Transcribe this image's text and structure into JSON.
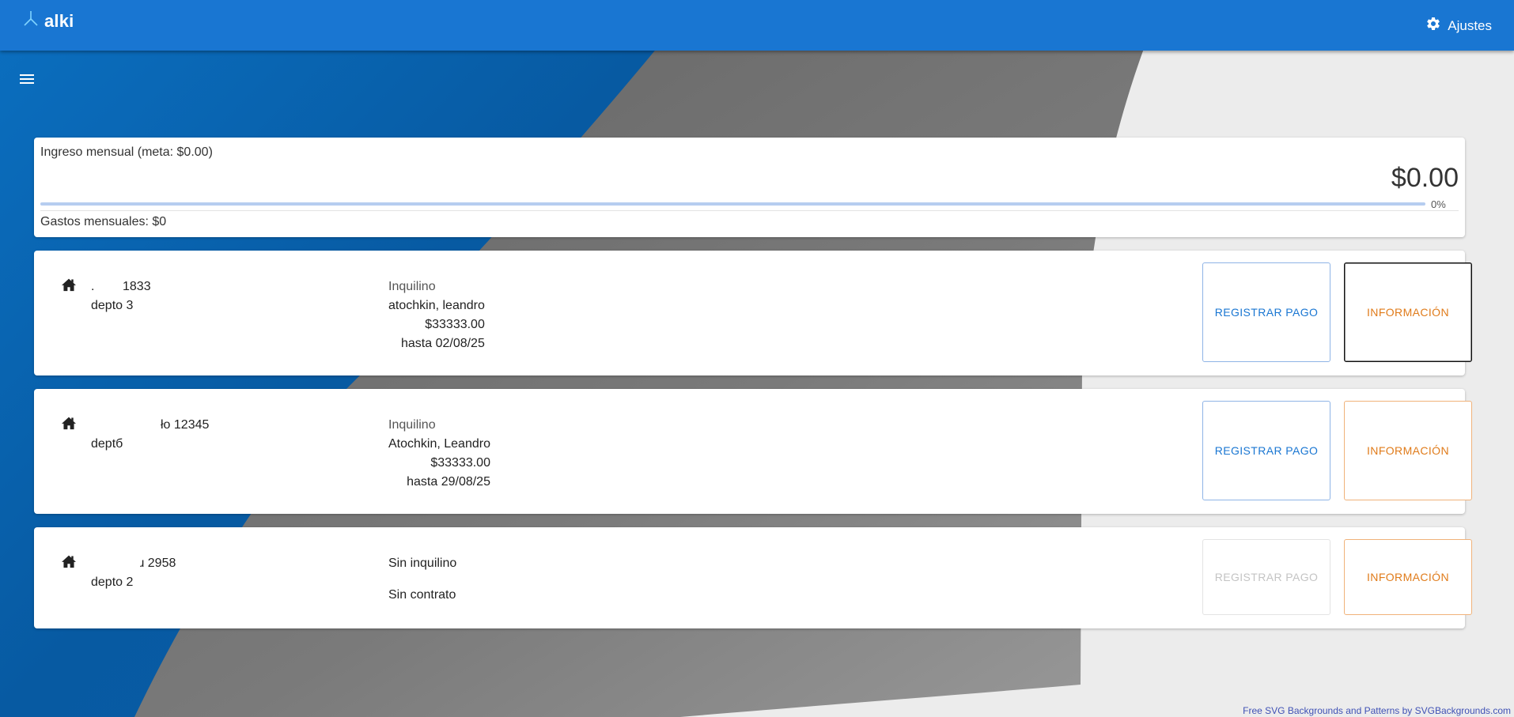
{
  "app": {
    "name": "alki",
    "logo_icon": "alki-logo-icon"
  },
  "header": {
    "settings_label": "Ajustes",
    "settings_icon": "gear-icon"
  },
  "menu_icon": "hamburger-menu-icon",
  "summary": {
    "income_label": "Ingreso mensual (meta: $0.00)",
    "income_amount": "$0.00",
    "progress_percent_text": "0%",
    "progress_value": 0,
    "expenses_label": "Gastos mensuales: $0"
  },
  "properties": [
    {
      "address_line1": ".        1833",
      "address_line2": "depto 3",
      "tenant_label": "Inquilino",
      "tenant_name": "atochkin, leandro",
      "amount": "$33333.00",
      "until": "hasta 02/08/25",
      "pay_button": "REGISTRAR PAGO",
      "info_button": "INFORMACIÓN"
    },
    {
      "address_line1": "ło 12345",
      "address_line2": "deptб",
      "tenant_label": "Inquilino",
      "tenant_name": "Atochkin, Leandro",
      "amount": "$33333.00",
      "until": "hasta 29/08/25",
      "pay_button": "REGISTRAR PAGO",
      "info_button": "INFORMACIÓN"
    },
    {
      "address_line1": "ɹ 2958",
      "address_line2": "depto 2",
      "no_tenant": "Sin inquilino",
      "no_contract": "Sin contrato",
      "pay_button": "REGISTRAR PAGO",
      "info_button": "INFORMACIÓN"
    }
  ],
  "footer_credit": "Free SVG Backgrounds and Patterns by SVGBackgrounds.com",
  "colors": {
    "appbar": "#1976d2",
    "primary": "#1976d2",
    "info_orange": "#e07b1a",
    "bg_blue": "#0a63b0",
    "bg_gray": "#6f6f6f"
  }
}
